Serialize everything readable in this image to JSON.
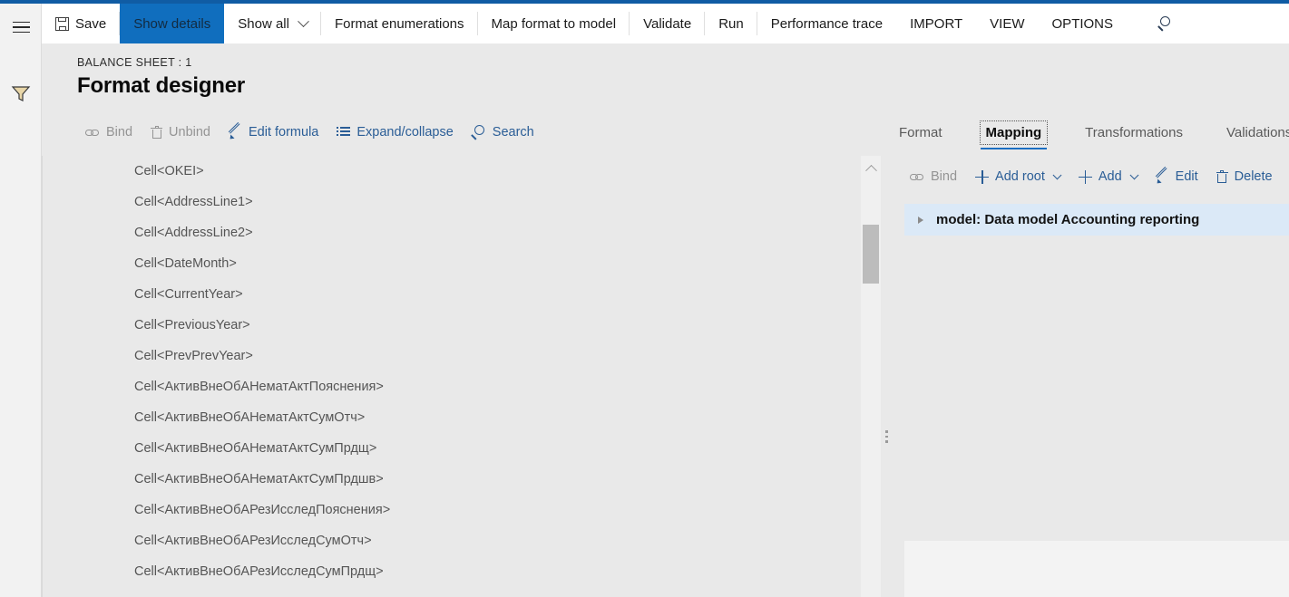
{
  "theme": {
    "accent": "#105ca4",
    "active_button_bg": "#106ebe",
    "link": "#2a5d96",
    "selected_row_bg": "#dbe9f7",
    "page_bg": "#e9e9e9"
  },
  "left_rail": {
    "menu_icon": "hamburger-icon",
    "filter_icon": "filter-icon"
  },
  "top_toolbar": {
    "items": [
      {
        "label": "Save",
        "icon": "save-icon",
        "active": false,
        "has_caret": false
      },
      {
        "label": "Show details",
        "icon": "",
        "active": true,
        "has_caret": false
      },
      {
        "label": "Show all",
        "icon": "",
        "active": false,
        "has_caret": true
      },
      {
        "label": "Format enumerations",
        "icon": "",
        "active": false,
        "has_caret": false
      },
      {
        "label": "Map format to model",
        "icon": "",
        "active": false,
        "has_caret": false
      },
      {
        "label": "Validate",
        "icon": "",
        "active": false,
        "has_caret": false
      },
      {
        "label": "Run",
        "icon": "",
        "active": false,
        "has_caret": false
      },
      {
        "label": "Performance trace",
        "icon": "",
        "active": false,
        "has_caret": false
      },
      {
        "label": "IMPORT",
        "icon": "",
        "active": false,
        "has_caret": false
      },
      {
        "label": "VIEW",
        "icon": "",
        "active": false,
        "has_caret": false
      },
      {
        "label": "OPTIONS",
        "icon": "",
        "active": false,
        "has_caret": false
      }
    ],
    "search_icon": "search-icon"
  },
  "header": {
    "breadcrumb": "BALANCE SHEET : 1",
    "title": "Format designer"
  },
  "format_commands": [
    {
      "label": "Bind",
      "icon": "link-icon",
      "disabled": true,
      "caret": false
    },
    {
      "label": "Unbind",
      "icon": "trash-icon",
      "disabled": true,
      "caret": false
    },
    {
      "label": "Edit formula",
      "icon": "pencil-icon",
      "disabled": false,
      "caret": false
    },
    {
      "label": "Expand/collapse",
      "icon": "list-icon",
      "disabled": false,
      "caret": false
    },
    {
      "label": "Search",
      "icon": "search-icon",
      "disabled": false,
      "caret": false
    }
  ],
  "format_tree": {
    "rows": [
      "Cell<OKEI>",
      "Cell<AddressLine1>",
      "Cell<AddressLine2>",
      "Cell<DateMonth>",
      "Cell<CurrentYear>",
      "Cell<PreviousYear>",
      "Cell<PrevPrevYear>",
      "Cell<АктивВнеОбАНематАктПояснения>",
      "Cell<АктивВнеОбАНематАктСумОтч>",
      "Cell<АктивВнеОбАНематАктСумПрдщ>",
      "Cell<АктивВнеОбАНематАктСумПрдшв>",
      "Cell<АктивВнеОбАРезИсследПояснения>",
      "Cell<АктивВнеОбАРезИсследСумОтч>",
      "Cell<АктивВнеОбАРезИсследСумПрдщ>"
    ]
  },
  "scrollbar": {
    "up_arrow_icon": "chevron-up-icon",
    "thumb": "scroll-thumb"
  },
  "splitter": {
    "handle_icon": "splitter-dots-icon"
  },
  "right_panel": {
    "tabs": [
      {
        "label": "Format",
        "active": false
      },
      {
        "label": "Mapping",
        "active": true
      },
      {
        "label": "Transformations",
        "active": false
      },
      {
        "label": "Validations",
        "active": false
      }
    ],
    "commands": [
      {
        "label": "Bind",
        "icon": "link-icon",
        "disabled": true,
        "caret": false
      },
      {
        "label": "Add root",
        "icon": "plus-icon",
        "disabled": false,
        "caret": true
      },
      {
        "label": "Add",
        "icon": "plus-icon",
        "disabled": false,
        "caret": true
      },
      {
        "label": "Edit",
        "icon": "pencil-icon",
        "disabled": false,
        "caret": false
      },
      {
        "label": "Delete",
        "icon": "trash-icon",
        "disabled": false,
        "caret": false
      }
    ],
    "tree": {
      "rows": [
        {
          "label": "model: Data model Accounting reporting",
          "expander_icon": "triangle-right-icon",
          "selected": true
        }
      ]
    }
  }
}
